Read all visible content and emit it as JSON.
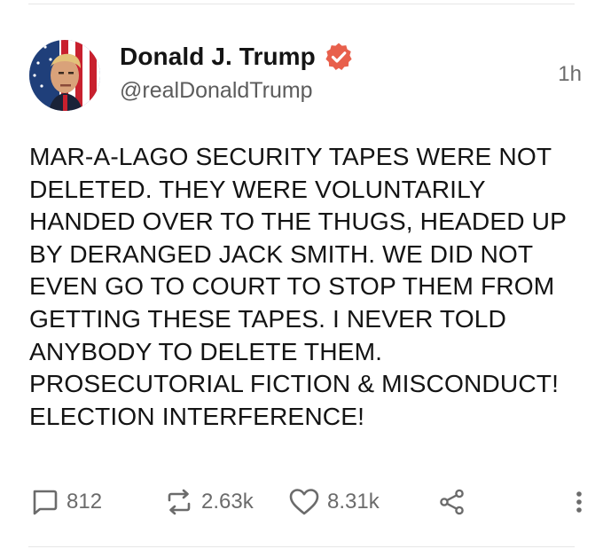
{
  "post": {
    "author": {
      "display_name": "Donald J. Trump",
      "handle": "@realDonaldTrump",
      "verified": true,
      "avatar": "profile-photo"
    },
    "timestamp": "1h",
    "text": "MAR-A-LAGO SECURITY TAPES WERE NOT\nDELETED. THEY WERE VOLUNTARILY\nHANDED OVER TO THE THUGS, HEADED UP\nBY DERANGED JACK SMITH. WE DID NOT\nEVEN GO TO COURT TO STOP THEM FROM\nGETTING THESE TAPES. I NEVER TOLD\nANYBODY TO DELETE THEM.\nPROSECUTORIAL FICTION & MISCONDUCT!\nELECTION INTERFERENCE!",
    "actions": {
      "reply": {
        "icon": "comment-icon",
        "count": "812"
      },
      "repost": {
        "icon": "repost-icon",
        "count": "2.63k"
      },
      "like": {
        "icon": "heart-icon",
        "count": "8.31k"
      },
      "share": {
        "icon": "share-icon"
      },
      "more": {
        "icon": "more-vertical-icon"
      }
    }
  },
  "colors": {
    "text": "#141414",
    "secondary": "#6b6b6b",
    "verified_badge": "#e8604c",
    "divider": "#e6e6e6"
  }
}
